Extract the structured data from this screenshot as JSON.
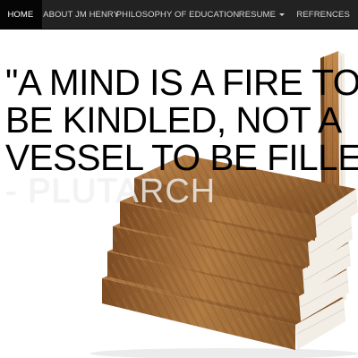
{
  "navbar": {
    "items": [
      {
        "label": "HOME",
        "active": true
      },
      {
        "label": "ABOUT JM HENRY",
        "active": false
      },
      {
        "label": "PHILOSOPHY OF EDUCATION",
        "active": false
      },
      {
        "label": "RESUME",
        "active": false,
        "has_dropdown": true
      },
      {
        "label": "REFRENCES",
        "active": false
      }
    ]
  },
  "hero": {
    "quote_lines": [
      "\"A MIND IS A FIRE TO",
      "BE KINDLED, NOT A",
      "VESSEL TO BE FILLED.\""
    ],
    "attribution": "- PLUTARCH",
    "image": "stack-of-books"
  },
  "colors": {
    "navbar_bg": "#222222",
    "nav_active_bg": "#050505",
    "nav_text": "#d6d6d6",
    "quote_text": "#000000",
    "attribution_text": "#ffffff",
    "book_cover": "#a0672f",
    "book_pages": "#f2eee6"
  }
}
